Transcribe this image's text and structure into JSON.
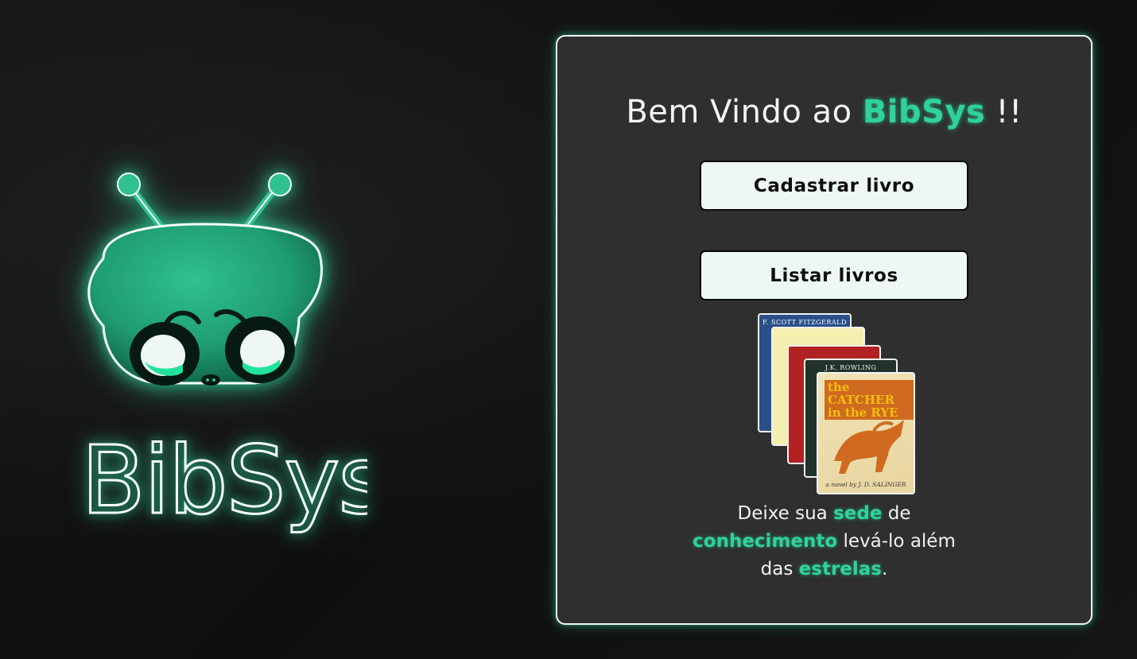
{
  "hero": {
    "logo_text": "BibSys",
    "mascot_icon": "alien-mascot-icon"
  },
  "card": {
    "title_prefix": "Bem Vindo ao ",
    "title_brand": "BibSys",
    "title_suffix": " !!",
    "buttons": {
      "cadastrar": "Cadastrar livro",
      "listar": "Listar livros"
    },
    "books": {
      "b1_author": "F. SCOTT FITZGERALD",
      "b4_author": "J.K. ROWLING",
      "b5_title_line1": "the CATCHER",
      "b5_title_line2": "in the RYE",
      "b5_byline": "a novel by J. D. SALINGER"
    },
    "tagline": {
      "t1": "Deixe sua ",
      "h1": "sede",
      "t2": " de",
      "h2": "conhecimento",
      "t3": " levá-lo além",
      "t4": "das ",
      "h3": "estrelas",
      "t5": "."
    }
  },
  "colors": {
    "accent": "#2ed39a",
    "background": "#111111",
    "card": "#2f2f2f",
    "button": "#eef6f6"
  }
}
